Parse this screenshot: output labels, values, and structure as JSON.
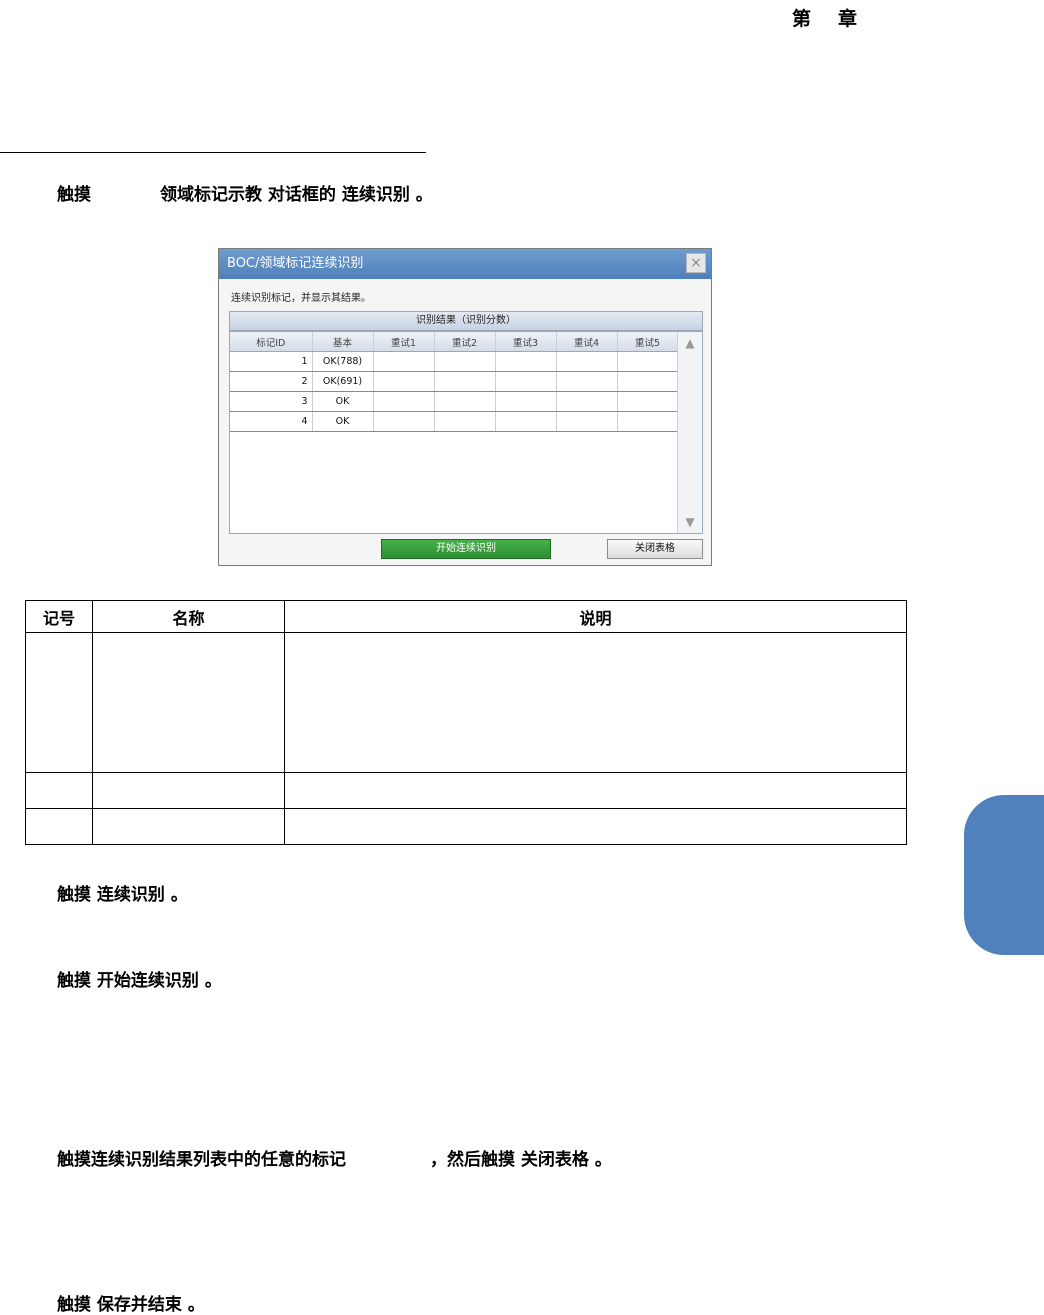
{
  "header": {
    "chapter_first": "第",
    "chapter_second": "章"
  },
  "steps": {
    "s1_a": "触摸",
    "s1_b": "领域标记示教 对话框的 连续识别 。",
    "s2": "触摸 连续识别 。",
    "s3": "触摸 开始连续识别 。",
    "s4_a": "触摸连续识别结果列表中的任意的标记",
    "s4_b": "，然后触摸 关闭表格 。",
    "s5": "触摸 保存并结束 。"
  },
  "dialog": {
    "title": "BOC/领域标记连续识别",
    "close_glyph": "×",
    "description": "连续识别标记，并显示其结果。",
    "results_header": "识别结果（识别分数）",
    "columns": [
      "标记ID",
      "基本",
      "重试1",
      "重试2",
      "重试3",
      "重试4",
      "重试5"
    ],
    "rows": [
      {
        "id": "1",
        "basic": "OK(788)"
      },
      {
        "id": "2",
        "basic": "OK(691)"
      },
      {
        "id": "3",
        "basic": "OK"
      },
      {
        "id": "4",
        "basic": "OK"
      }
    ],
    "scroll_up_icon": "arrow-up-icon",
    "scroll_down_icon": "arrow-down-icon",
    "start_button": "开始连续识别",
    "close_button": "关闭表格",
    "start_button_color": "#2e9a33",
    "title_bar_color": "#5b8cc6"
  },
  "info_table": {
    "headers": [
      "记号",
      "名称",
      "说明"
    ]
  },
  "side_tab_color": "#4f81bd"
}
